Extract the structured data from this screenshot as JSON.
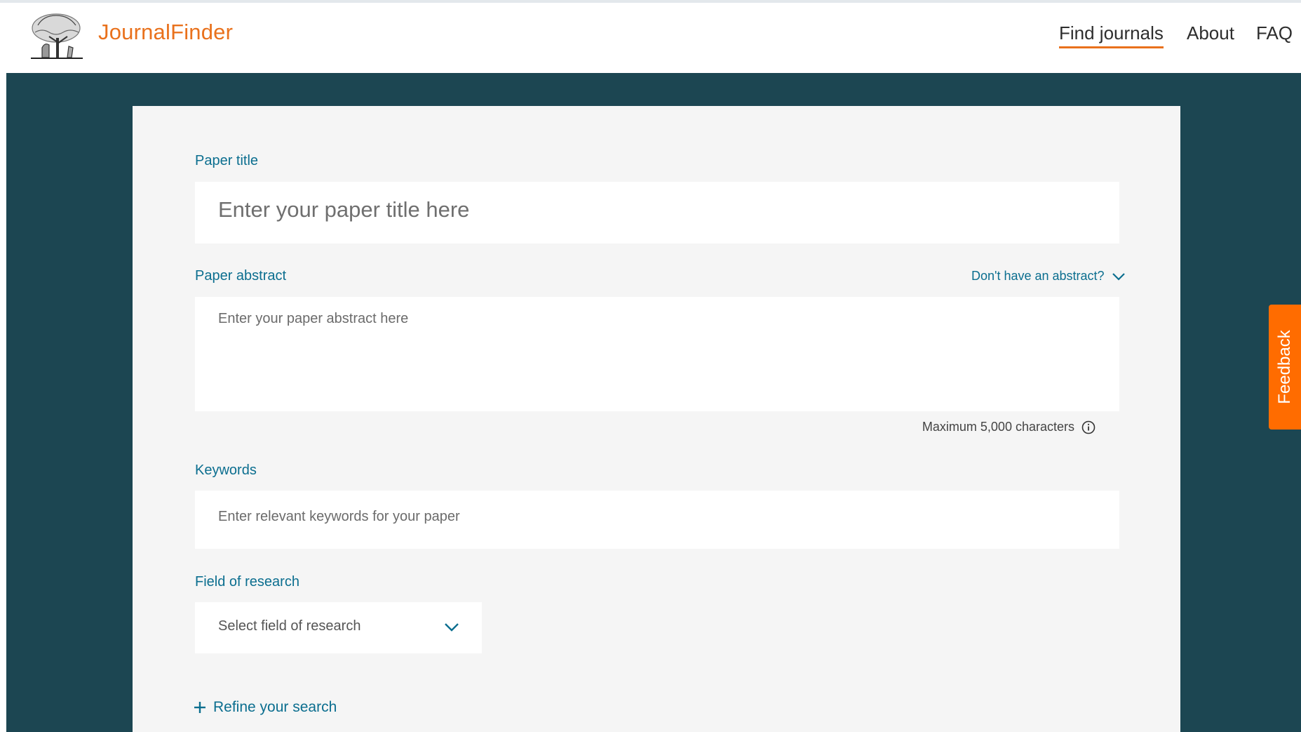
{
  "header": {
    "logo_icon": "elsevier-tree-logo-icon",
    "brand": "JournalFinder",
    "nav": [
      {
        "label": "Find journals",
        "active": true
      },
      {
        "label": "About",
        "active": false
      },
      {
        "label": "FAQ",
        "active": false
      }
    ]
  },
  "form": {
    "title_label": "Paper title",
    "title_placeholder": "Enter your paper title here",
    "abstract_label": "Paper abstract",
    "no_abstract_link": "Don't have an abstract?",
    "abstract_placeholder": "Enter your paper abstract here",
    "max_chars": "Maximum 5,000 characters",
    "keywords_label": "Keywords",
    "keywords_placeholder": "Enter relevant keywords for your paper",
    "field_label": "Field of research",
    "field_placeholder": "Select field of research",
    "refine_label": "Refine your search"
  },
  "feedback_tab": "Feedback",
  "colors": {
    "brand_orange": "#e9711c",
    "hero_bg": "#1c4652",
    "link_teal": "#0b6e8f",
    "feedback_orange": "#ff6c00"
  }
}
